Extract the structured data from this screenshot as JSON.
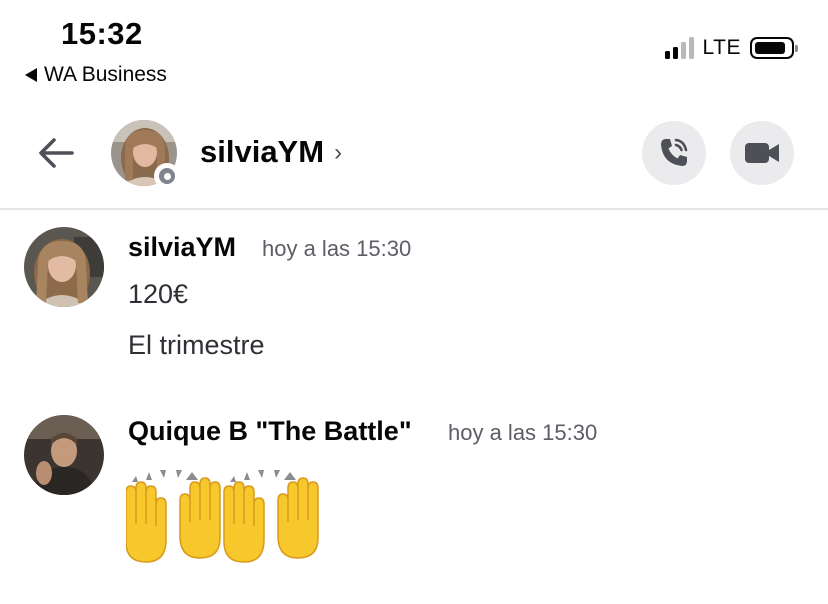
{
  "status_bar": {
    "time": "15:32",
    "back_app_label": "WA Business",
    "network": "LTE",
    "signal_bars_filled": 2,
    "signal_bars_total": 4,
    "battery_level": 0.8
  },
  "header": {
    "channel_name": "silviaYM",
    "back_icon": "arrow-left-icon",
    "call_icon": "phone-call-icon",
    "video_icon": "video-camera-icon",
    "presence": "offline"
  },
  "messages": [
    {
      "author": "silviaYM",
      "time": "hoy a las 15:30",
      "lines": [
        "120€",
        "El trimestre"
      ]
    },
    {
      "author": "Quique B \"The Battle\"",
      "time": "hoy a las 15:30",
      "emoji": "raising-hands-emoji",
      "emoji_count": 2
    }
  ],
  "colors": {
    "text": "#060607",
    "muted": "#5c5e66",
    "button_bg": "#ebebed",
    "icon": "#4e5058",
    "emoji_yellow": "#f7c82c",
    "divider": "#e3e5e8"
  }
}
